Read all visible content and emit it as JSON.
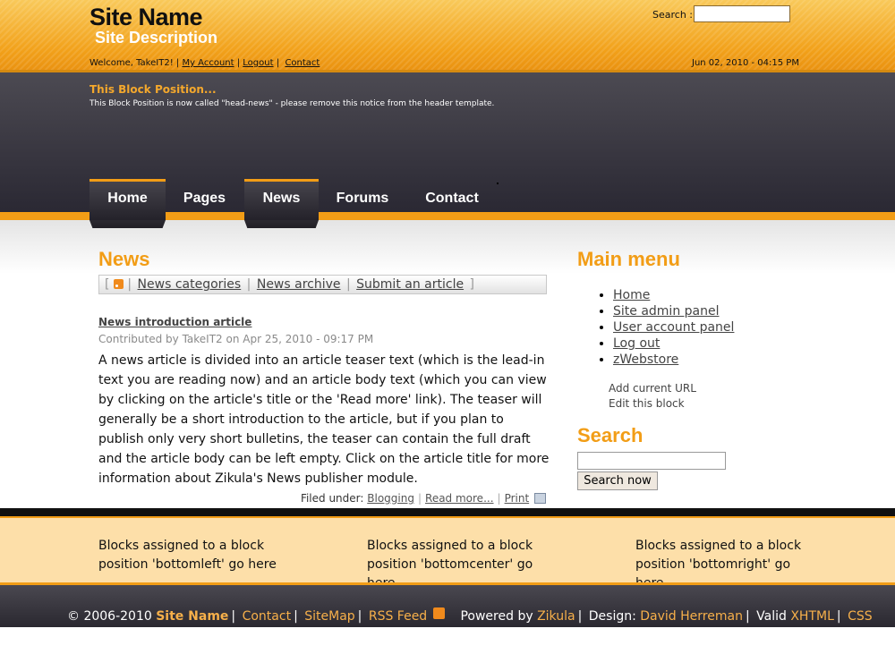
{
  "header": {
    "site_name": "Site Name",
    "site_description": "Site Description",
    "search_label": "Search :",
    "welcome_text": "Welcome, TakeIT2! |",
    "links": [
      "My Account",
      "Logout",
      "Contact"
    ],
    "date": "Jun 02, 2010 - 04:15 PM"
  },
  "notice": {
    "title": "This Block Position...",
    "text": "This Block Position is now called \"head-news\" - please remove this notice from the header template."
  },
  "nav": {
    "tabs": [
      "Home",
      "Pages",
      "News",
      "Forums",
      "Contact"
    ],
    "active": [
      "Home",
      "News"
    ]
  },
  "main": {
    "heading": "News",
    "toolbar": {
      "open_bracket": "[",
      "close_bracket": "]",
      "sep": "|",
      "links": [
        "News categories",
        "News archive",
        "Submit an article"
      ]
    },
    "article": {
      "title": "News introduction article",
      "meta": "Contributed by TakeIT2 on Apr 25, 2010 - 09:17 PM",
      "body": "A news article is divided into an article teaser text (which is the lead-in text you are reading now) and an article body text (which you can view by clicking on the article's title or the 'Read more' link). The teaser will generally be a short introduction to the article, but if you plan to publish only very short bulletins, the teaser can contain the full draft and the article body can be left empty. Click on the article title for more information about Zikula's News publisher module.",
      "filed_label": "Filed under:",
      "category": "Blogging",
      "read_more": "Read more...",
      "print": "Print"
    }
  },
  "sidebar": {
    "menu_heading": "Main menu",
    "menu_items": [
      "Home",
      "Site admin panel",
      "User account panel",
      "Log out",
      "zWebstore"
    ],
    "add_url": "Add current URL",
    "edit_block": "Edit this block",
    "search_heading": "Search",
    "search_button": "Search now"
  },
  "bottom_blocks": {
    "left": "Blocks assigned to a block position 'bottomleft' go here",
    "center": "Blocks assigned to a block position 'bottomcenter' go here",
    "right": "Blocks assigned to a block position 'bottomright' go here"
  },
  "footer": {
    "copyright": "© 2006-2010",
    "site_name": "Site Name",
    "contact": "Contact",
    "sitemap": "SiteMap",
    "rss": "RSS Feed",
    "powered_by": "Powered by",
    "zikula": "Zikula",
    "design_label": "Design:",
    "designer": "David Herreman",
    "valid_label": "Valid",
    "xhtml": "XHTML",
    "css": "CSS",
    "sep": "|"
  },
  "colors": {
    "accent": "#f29d16",
    "header": "#f2a11a",
    "dark": "#2a2833",
    "bottom_blocks_bg": "#fddfa9"
  }
}
